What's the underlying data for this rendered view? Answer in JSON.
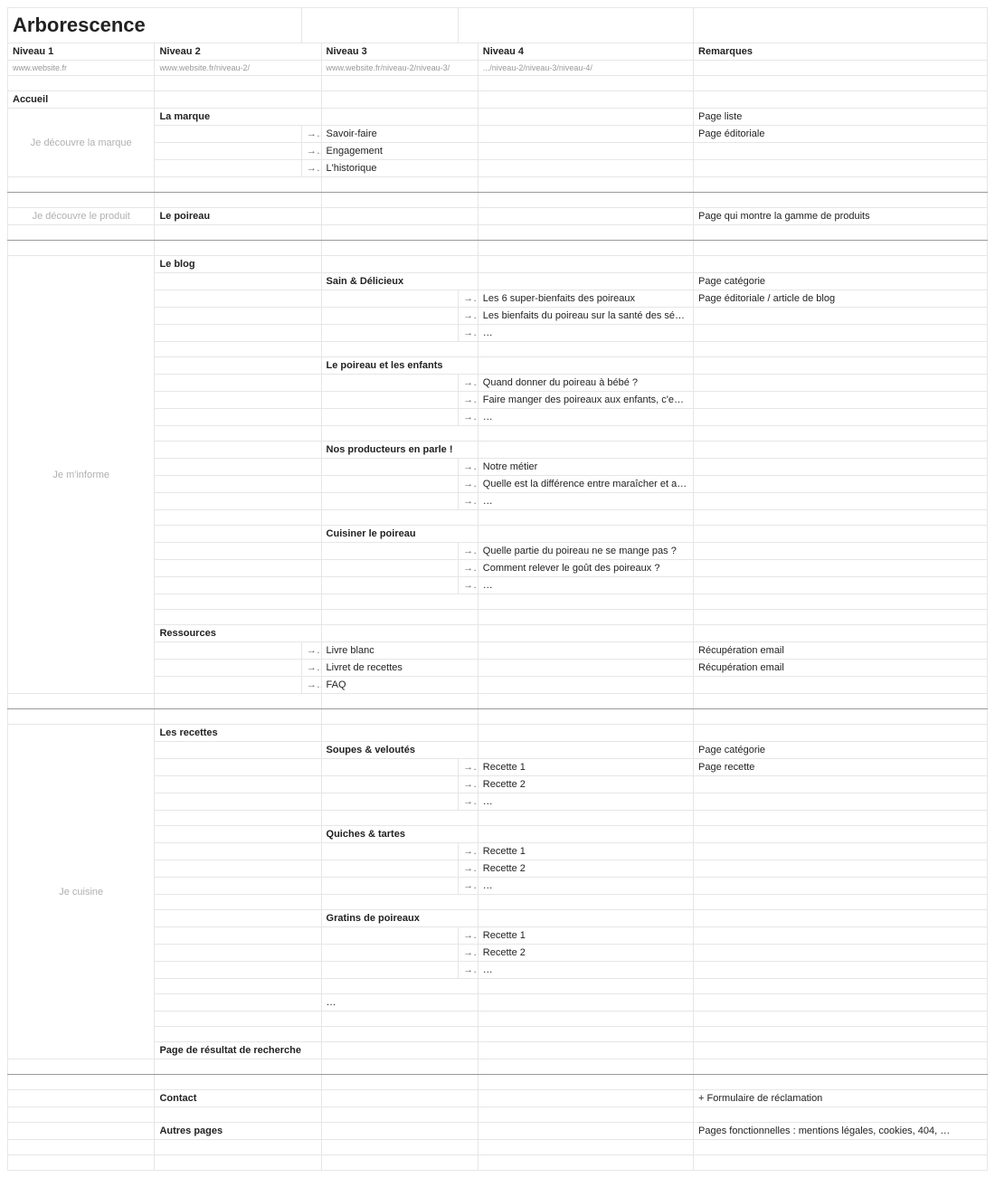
{
  "title": "Arborescence",
  "arrow": "→",
  "ellipsis": "…",
  "headers": {
    "n1": "Niveau 1",
    "n2": "Niveau 2",
    "n3": "Niveau 3",
    "n4": "Niveau 4",
    "rem": "Remarques"
  },
  "urls": {
    "n1": "www.website.fr",
    "n2": "www.website.fr/niveau-2/",
    "n3": "www.website.fr/niveau-2/niveau-3/",
    "n4": ".../niveau-2/niveau-3/niveau-4/"
  },
  "n1": {
    "accueil": "Accueil",
    "decouvre_marque": "Je découvre la marque",
    "decouvre_produit": "Je découvre le produit",
    "minforme": "Je m'informe",
    "cuisine": "Je cuisine"
  },
  "n2": {
    "la_marque": "La marque",
    "le_poireau": "Le poireau",
    "le_blog": "Le blog",
    "ressources": "Ressources",
    "les_recettes": "Les recettes",
    "recherche": "Page de résultat de recherche",
    "contact": "Contact",
    "autres": "Autres pages"
  },
  "n3": {
    "savoir_faire": "Savoir-faire",
    "engagement": "Engagement",
    "historique": "L'historique",
    "sain": "Sain & Délicieux",
    "enfants": "Le poireau et les enfants",
    "producteurs": "Nos producteurs en parle !",
    "cuisiner": "Cuisiner le poireau",
    "livre_blanc": "Livre blanc",
    "livret": "Livret de recettes",
    "faq": "FAQ",
    "soupes": "Soupes & veloutés",
    "quiches": "Quiches & tartes",
    "gratins": "Gratins de poireaux"
  },
  "n4": {
    "bienfaits6": "Les 6 super-bienfaits des poireaux",
    "seniors": "Les bienfaits du poireau sur la santé des séniors",
    "bebe": "Quand donner du poireau à bébé ?",
    "enfants_facile": "Faire manger des poireaux aux enfants, c'est facile !",
    "metier": "Notre métier",
    "diff": "Quelle est la différence entre maraîcher et agriculteur ?",
    "partie": "Quelle partie du poireau ne se mange pas ?",
    "gout": "Comment relever le goût des poireaux ?",
    "r1": "Recette 1",
    "r2": "Recette 2"
  },
  "rem": {
    "page_liste": "Page liste",
    "page_edit": "Page éditoriale",
    "gamme": "Page qui montre la gamme de produits",
    "page_cat": "Page catégorie",
    "page_blog": "Page éditoriale / article de blog",
    "recup_email": "Récupération email",
    "page_recette": "Page recette",
    "reclamation": "+ Formulaire de réclamation",
    "fonctionnelles": "Pages fonctionnelles : mentions légales, cookies, 404, …"
  }
}
